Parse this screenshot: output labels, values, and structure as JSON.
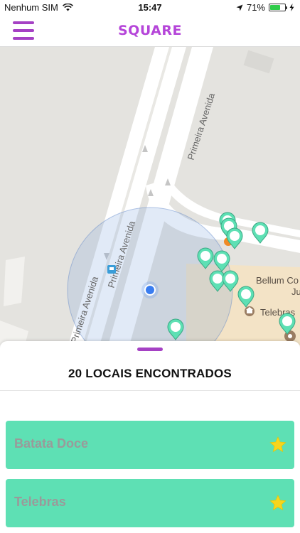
{
  "status_bar": {
    "carrier": "Nenhum SIM",
    "time": "15:47",
    "battery": "71%",
    "battery_level": 0.71,
    "icons": [
      "wifi-icon",
      "location-arrow-icon",
      "battery-icon",
      "charging-bolt-icon"
    ]
  },
  "header": {
    "title": "SQUARE",
    "menu_icon": "hamburger-menu-icon",
    "accent_color": "#a541c4"
  },
  "map": {
    "street_labels": [
      "Primeira Avenida",
      "Primeira Avenida",
      "Primeira Avenida"
    ],
    "place_labels": [
      "Bellum Co",
      "Ju",
      "Telebras"
    ],
    "marker_color": "#5ee0b4",
    "user_location_color": "#3a7df0",
    "icons": [
      "bus-stop-icon",
      "museum-icon",
      "user-location-icon",
      "map-pin-icon"
    ]
  },
  "sheet": {
    "title": "20 LOCAIS ENCONTRADOS",
    "items": [
      {
        "name": "Batata Doce",
        "icon": "star-icon"
      },
      {
        "name": "Telebras",
        "icon": "star-icon"
      }
    ],
    "card_color": "#5ee0b4",
    "star_color": "#f7d51d"
  }
}
